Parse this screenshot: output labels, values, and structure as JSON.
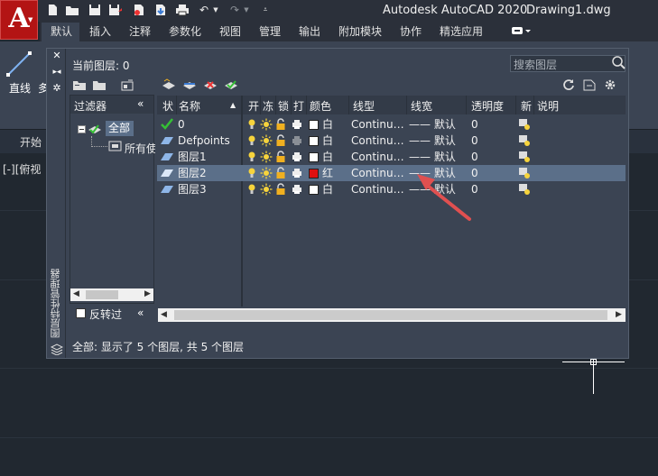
{
  "app": {
    "logo_letter": "A",
    "title_app": "Autodesk AutoCAD 2020",
    "title_doc": "Drawing1.dwg"
  },
  "ribbon": {
    "tabs": [
      "默认",
      "插入",
      "注释",
      "参数化",
      "视图",
      "管理",
      "输出",
      "附加模块",
      "协作",
      "精选应用"
    ],
    "active_tab": "默认",
    "panel": {
      "line_label": "直线",
      "multi_label": "多"
    }
  },
  "file_tabs": {
    "start": "开始"
  },
  "viewport": {
    "label": "[-][俯视"
  },
  "palette": {
    "vertical_title": "图层特性管理器",
    "current_layer_label": "当前图层: 0",
    "search_placeholder": "搜索图层",
    "filter_pane": {
      "header": "过滤器",
      "collapse_glyph": "«",
      "tree": {
        "all": "全部",
        "used": "所有使"
      },
      "invert_label": "反转过"
    },
    "columns": [
      "状",
      "名称",
      "开",
      "冻",
      "锁",
      "打",
      "颜色",
      "线型",
      "线宽",
      "透明度",
      "新",
      "说明"
    ],
    "layers": [
      {
        "name": "0",
        "color_name": "白",
        "color": "#ffffff",
        "linetype": "Continu…",
        "lineweight": "—— 默认",
        "transparency": "0",
        "current": true,
        "selected": false
      },
      {
        "name": "Defpoints",
        "color_name": "白",
        "color": "#ffffff",
        "linetype": "Continu…",
        "lineweight": "—— 默认",
        "transparency": "0",
        "current": false,
        "selected": false
      },
      {
        "name": "图层1",
        "color_name": "白",
        "color": "#ffffff",
        "linetype": "Continu…",
        "lineweight": "—— 默认",
        "transparency": "0",
        "current": false,
        "selected": false
      },
      {
        "name": "图层2",
        "color_name": "红",
        "color": "#e01010",
        "linetype": "Continu…",
        "lineweight": "—— 默认",
        "transparency": "0",
        "current": false,
        "selected": true
      },
      {
        "name": "图层3",
        "color_name": "白",
        "color": "#ffffff",
        "linetype": "Continu…",
        "lineweight": "—— 默认",
        "transparency": "0",
        "current": false,
        "selected": false
      }
    ],
    "status": "全部: 显示了 5 个图层, 共 5 个图层"
  },
  "colors": {
    "annotation_arrow": "#e05050",
    "accent": "#5b6f89"
  }
}
